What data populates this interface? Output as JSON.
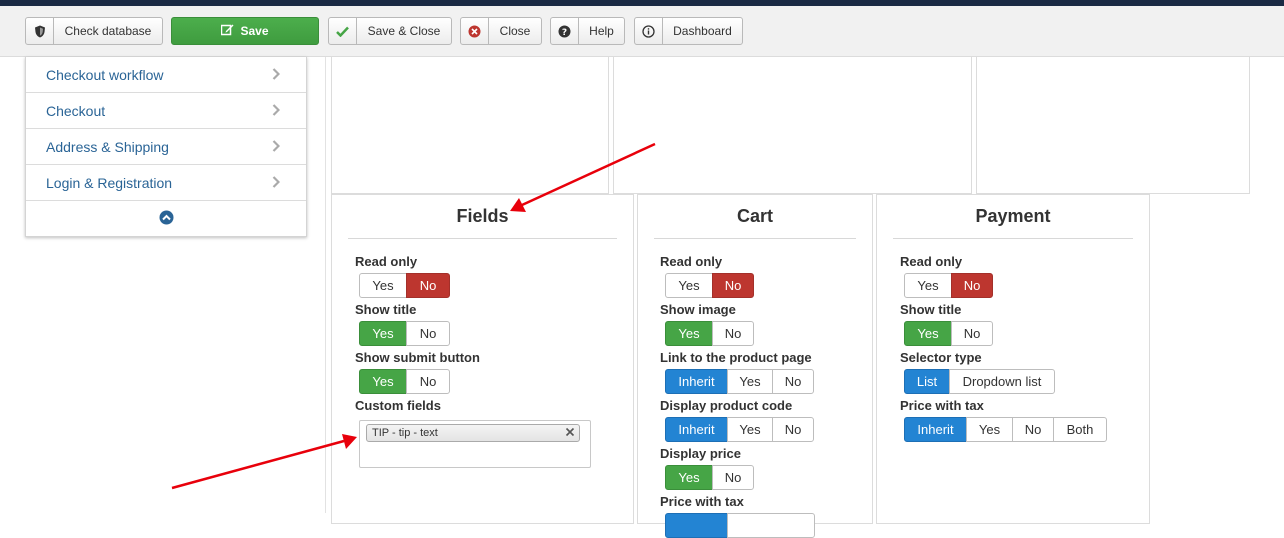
{
  "toolbar": {
    "check_database": "Check database",
    "save": "Save",
    "save_close": "Save & Close",
    "close": "Close",
    "help": "Help",
    "dashboard": "Dashboard"
  },
  "sidebar": {
    "items": [
      {
        "label": "Checkout workflow"
      },
      {
        "label": "Checkout"
      },
      {
        "label": "Address & Shipping"
      },
      {
        "label": "Login & Registration"
      }
    ]
  },
  "panels": {
    "fields": {
      "title": "Fields",
      "read_only": {
        "label": "Read only",
        "yes": "Yes",
        "no": "No",
        "selected": "No"
      },
      "show_title": {
        "label": "Show title",
        "yes": "Yes",
        "no": "No",
        "selected": "Yes"
      },
      "show_submit": {
        "label": "Show submit button",
        "yes": "Yes",
        "no": "No",
        "selected": "Yes"
      },
      "custom_fields": {
        "label": "Custom fields",
        "tags": [
          "TIP - tip - text"
        ]
      }
    },
    "cart": {
      "title": "Cart",
      "read_only": {
        "label": "Read only",
        "yes": "Yes",
        "no": "No",
        "selected": "No"
      },
      "show_image": {
        "label": "Show image",
        "yes": "Yes",
        "no": "No",
        "selected": "Yes"
      },
      "link_product": {
        "label": "Link to the product page",
        "inherit": "Inherit",
        "yes": "Yes",
        "no": "No",
        "selected": "Inherit"
      },
      "product_code": {
        "label": "Display product code",
        "inherit": "Inherit",
        "yes": "Yes",
        "no": "No",
        "selected": "Inherit"
      },
      "display_price": {
        "label": "Display price",
        "yes": "Yes",
        "no": "No",
        "selected": "Yes"
      },
      "price_tax": {
        "label": "Price with tax"
      }
    },
    "payment": {
      "title": "Payment",
      "read_only": {
        "label": "Read only",
        "yes": "Yes",
        "no": "No",
        "selected": "No"
      },
      "show_title": {
        "label": "Show title",
        "yes": "Yes",
        "no": "No",
        "selected": "Yes"
      },
      "selector_type": {
        "label": "Selector type",
        "list": "List",
        "dropdown": "Dropdown list",
        "selected": "List"
      },
      "price_tax": {
        "label": "Price with tax",
        "inherit": "Inherit",
        "yes": "Yes",
        "no": "No",
        "both": "Both",
        "selected": "Inherit"
      }
    }
  },
  "colors": {
    "save_green": "#46a546",
    "active_red": "#bd362f",
    "active_blue": "#2384d3",
    "link_blue": "#2a6496",
    "annotation_arrow": "#e8000b"
  },
  "icons": {
    "check_database": "shield-icon",
    "save": "edit-icon",
    "save_close": "checkmark-icon",
    "close": "close-circle-icon",
    "help": "question-circle-icon",
    "dashboard": "info-circle-icon",
    "sidebar_chevron": "chevron-right-icon",
    "collapse": "chevron-up-circle-icon"
  }
}
